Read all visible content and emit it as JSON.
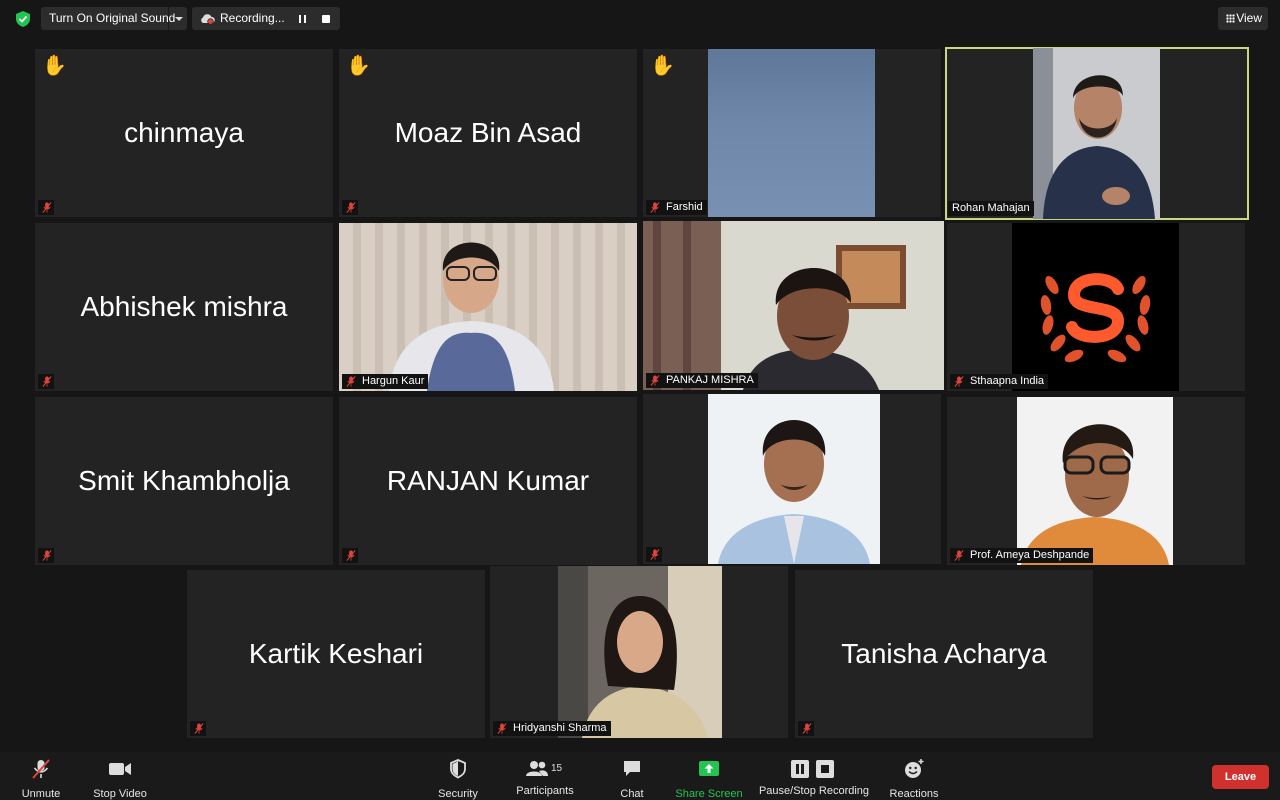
{
  "topbar": {
    "original_sound": "Turn On Original Sound",
    "recording": "Recording...",
    "view": "View"
  },
  "tiles": [
    {
      "name": "chinmaya",
      "hand": "✋"
    },
    {
      "name": "Moaz Bin Asad",
      "hand": "✋"
    },
    {
      "name": "Farshid",
      "hand": "✋"
    },
    {
      "name": "Rohan Mahajan"
    },
    {
      "name": "Abhishek mishra"
    },
    {
      "name": "Hargun Kaur"
    },
    {
      "name": "PANKAJ MISHRA"
    },
    {
      "name": "Sthaapna India"
    },
    {
      "name": "Smit Khambholja"
    },
    {
      "name": "RANJAN Kumar"
    },
    {
      "name": ""
    },
    {
      "name": "Prof. Ameya Deshpande"
    },
    {
      "name": "Kartik Keshari"
    },
    {
      "name": "Hridyanshi Sharma"
    },
    {
      "name": "Tanisha Acharya"
    }
  ],
  "toolbar": {
    "unmute": "Unmute",
    "stop_video": "Stop Video",
    "security": "Security",
    "participants": "Participants",
    "participants_count": "15",
    "chat": "Chat",
    "share_screen": "Share Screen",
    "recording": "Pause/Stop Recording",
    "reactions": "Reactions",
    "leave": "Leave"
  },
  "colors": {
    "active_speaker": "#c6d97f",
    "share_green": "#23c552",
    "leave_red": "#d0312d",
    "muted_red": "#e0443a"
  }
}
